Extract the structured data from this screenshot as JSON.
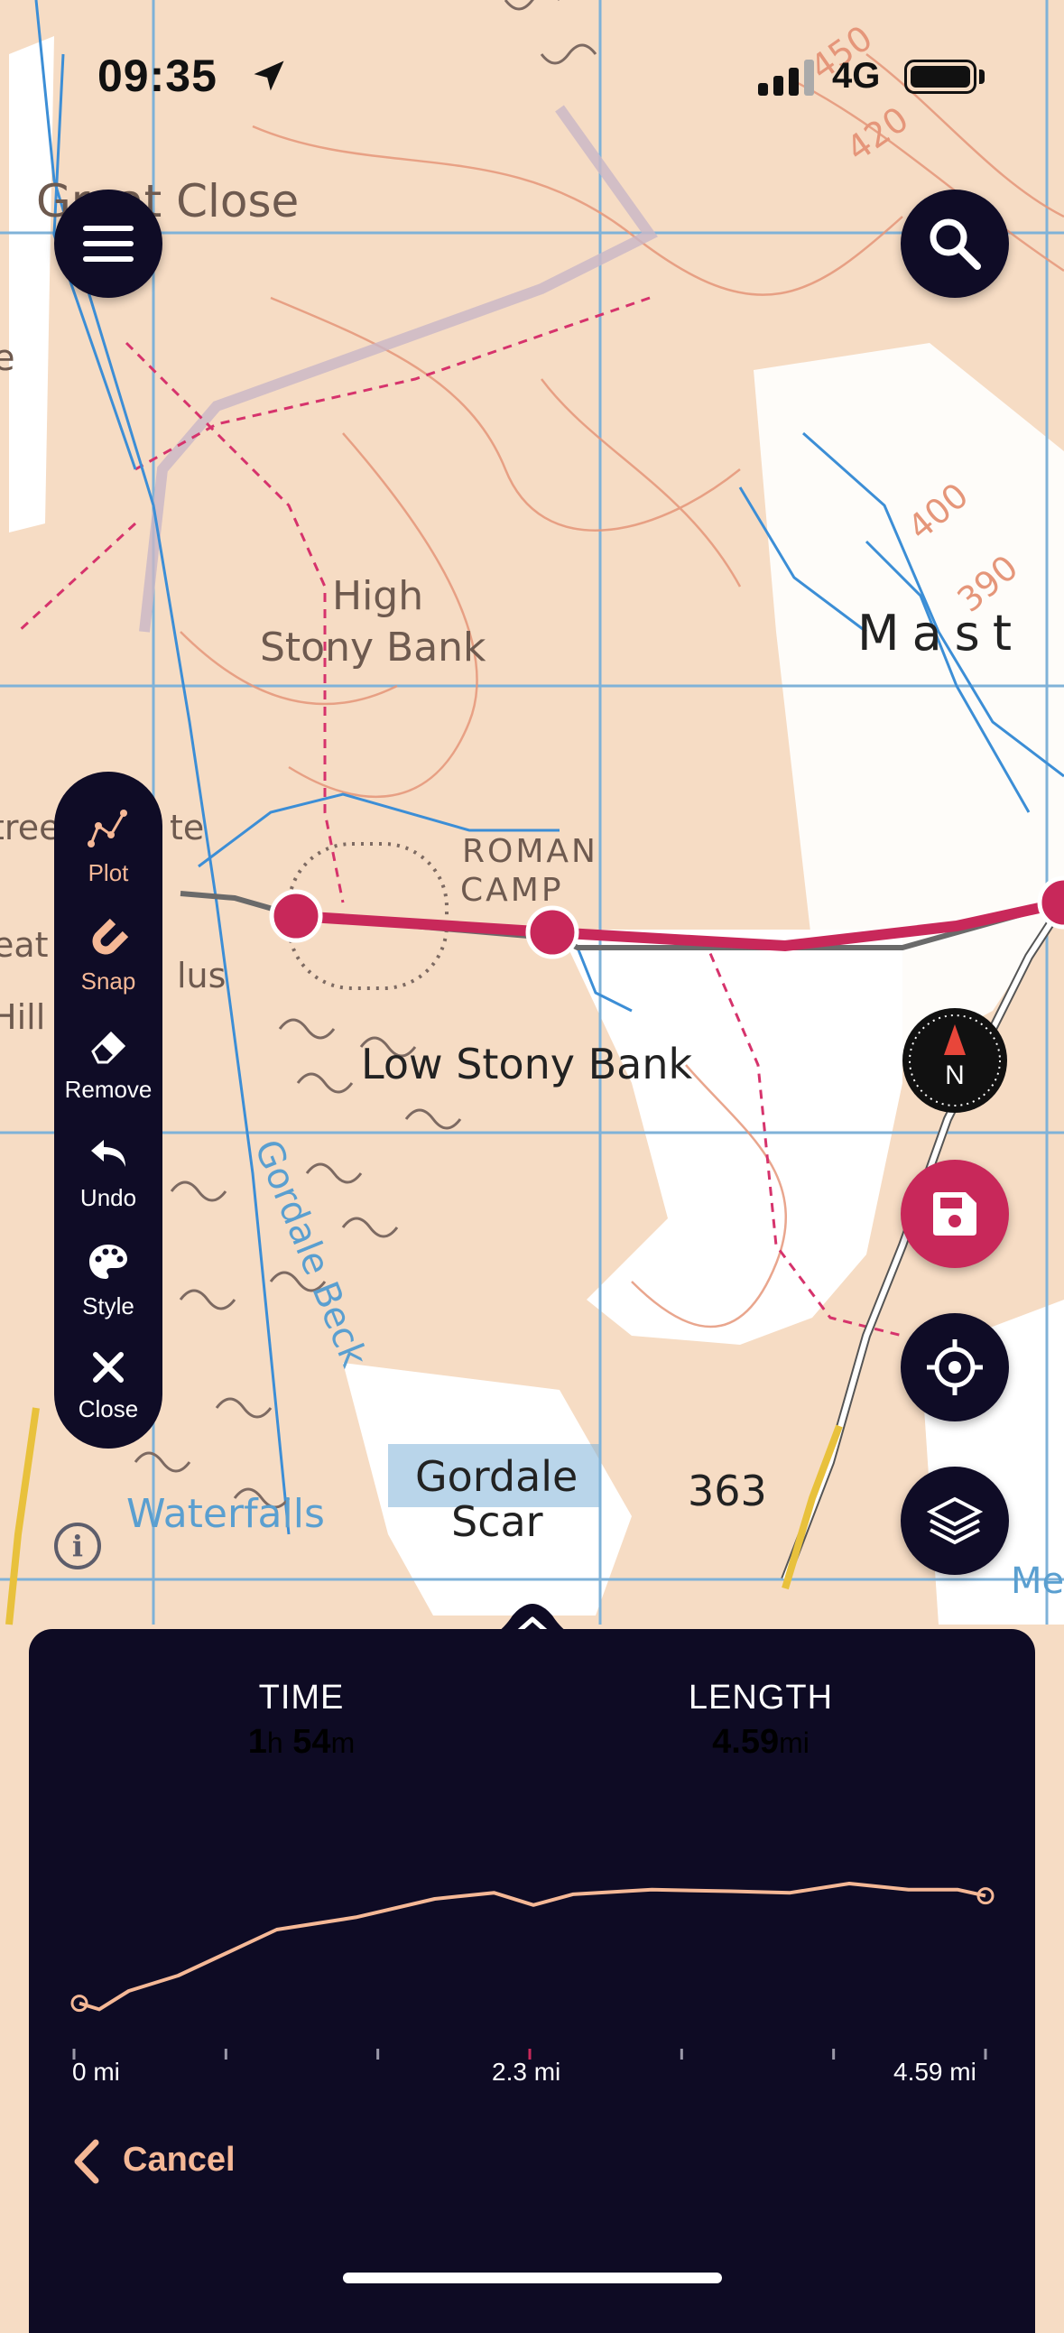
{
  "status_bar": {
    "time": "09:35",
    "network": "4G"
  },
  "map": {
    "labels": {
      "great_close": "Great Close",
      "high_stony_bank_1": "High",
      "high_stony_bank_2": "Stony Bank",
      "mastiles": "Mast",
      "roman_camp_1": "ROMAN",
      "roman_camp_2": "CAMP",
      "low_stony_bank": "Low Stony Bank",
      "gordale_beck": "Gordale Beck",
      "gordale_scar_1": "Gordale",
      "gordale_scar_2": "Scar",
      "spot_height": "363",
      "waterfalls": "Waterfalls",
      "contour_450": "450",
      "contour_420": "420",
      "contour_400": "400",
      "contour_390": "390",
      "tree_frag": "tree",
      "te_frag": "te",
      "eat_frag": "eat",
      "ilus_frag": "lus",
      "hill_frag": "Hill",
      "e_frag": "e",
      "me_frag": "Me"
    }
  },
  "toolbar": {
    "items": [
      {
        "label": "Plot",
        "icon": "plot-icon",
        "active": true
      },
      {
        "label": "Snap",
        "icon": "magnet-icon",
        "active": true
      },
      {
        "label": "Remove",
        "icon": "eraser-icon",
        "active": false
      },
      {
        "label": "Undo",
        "icon": "undo-icon",
        "active": false
      },
      {
        "label": "Style",
        "icon": "palette-icon",
        "active": false
      },
      {
        "label": "Close",
        "icon": "close-icon",
        "active": false
      }
    ]
  },
  "compass": {
    "letter": "N"
  },
  "info": {
    "glyph": "i"
  },
  "route_panel": {
    "time_label": "TIME",
    "time_hours": "1",
    "time_hours_unit": "h",
    "time_minutes": "54",
    "time_minutes_unit": "m",
    "length_label": "LENGTH",
    "length_value": "4.59",
    "length_unit": "mi",
    "cancel_label": "Cancel"
  },
  "colors": {
    "accent": "#c8285a",
    "panel": "#0e0b24",
    "profile": "#f5b896",
    "map_bg": "#f6dcc4"
  },
  "chart_data": {
    "type": "area",
    "x_tick_labels": [
      "0 mi",
      "2.3 mi",
      "4.59 mi"
    ],
    "x": [
      0,
      0.1,
      0.25,
      0.5,
      0.75,
      1.0,
      1.4,
      1.8,
      2.1,
      2.3,
      2.5,
      2.9,
      3.3,
      3.6,
      3.9,
      4.2,
      4.45,
      4.59
    ],
    "y": [
      0.12,
      0.08,
      0.2,
      0.3,
      0.45,
      0.6,
      0.68,
      0.8,
      0.84,
      0.76,
      0.83,
      0.86,
      0.85,
      0.84,
      0.9,
      0.86,
      0.86,
      0.82
    ],
    "xlim": [
      0,
      4.59
    ],
    "grid": false
  }
}
